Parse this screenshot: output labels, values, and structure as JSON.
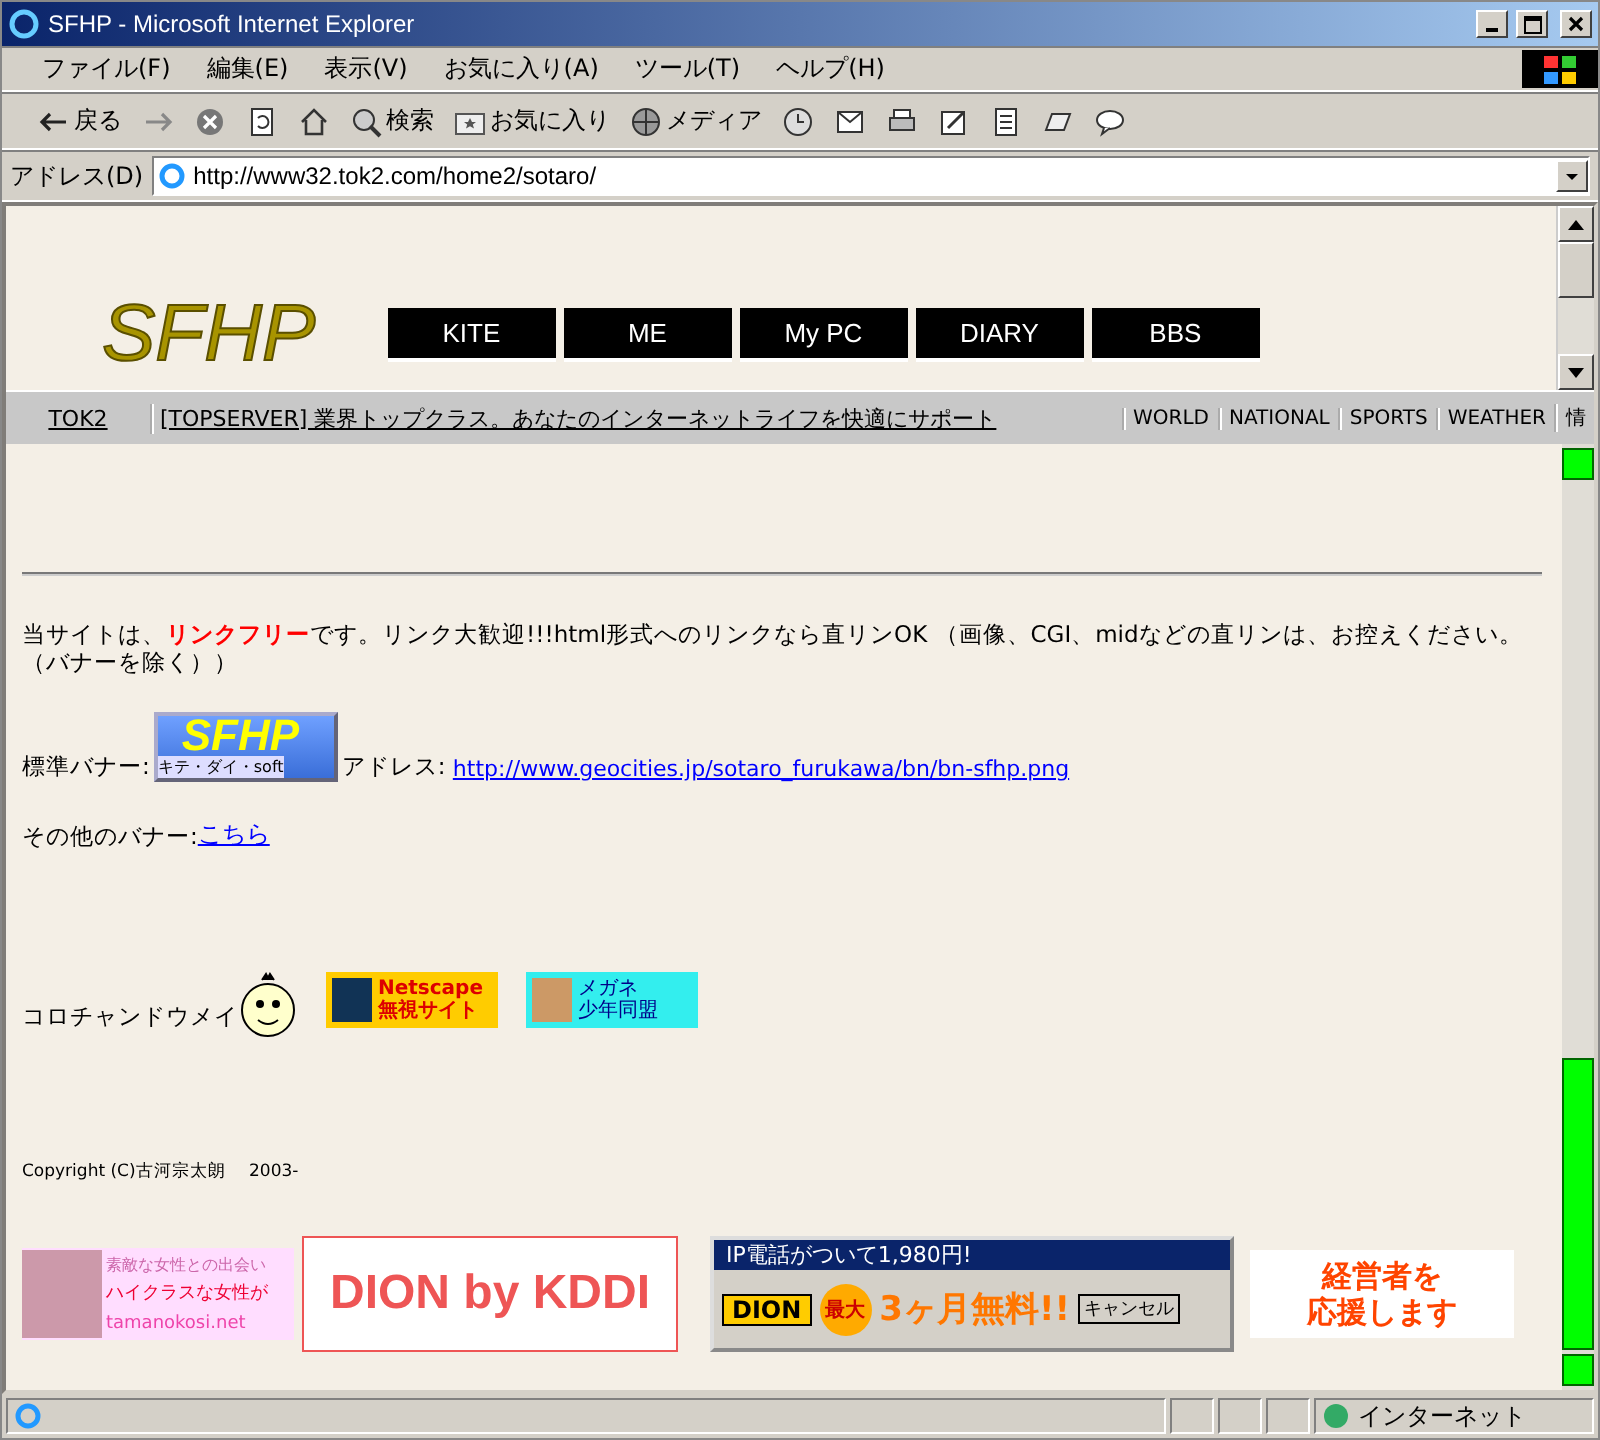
{
  "window": {
    "title": "SFHP - Microsoft Internet Explorer"
  },
  "menu": [
    "ファイル(F)",
    "編集(E)",
    "表示(V)",
    "お気に入り(A)",
    "ツール(T)",
    "ヘルプ(H)"
  ],
  "toolbar": [
    {
      "kind": "back",
      "label": "戻る"
    },
    {
      "kind": "forward"
    },
    {
      "kind": "stop"
    },
    {
      "kind": "refresh"
    },
    {
      "kind": "home"
    },
    {
      "kind": "search",
      "label": "検索"
    },
    {
      "kind": "favorites",
      "label": "お気に入り"
    },
    {
      "kind": "media",
      "label": "メディア"
    },
    {
      "kind": "history"
    },
    {
      "kind": "mail"
    },
    {
      "kind": "print"
    },
    {
      "kind": "edit"
    },
    {
      "kind": "discuss"
    },
    {
      "kind": "messenger"
    },
    {
      "kind": "chat"
    }
  ],
  "address": {
    "label": "アドレス(D)",
    "url": "http://www32.tok2.com/home2/sotaro/"
  },
  "header": {
    "logo": "SFHP",
    "nav": [
      "KITE",
      "ME",
      "My PC",
      "DIARY",
      "BBS"
    ]
  },
  "adbar": {
    "brand": "TOK2",
    "ad": "[TOPSERVER] 業界トップクラス。あなたのインターネットライフを快適にサポート",
    "links": [
      "WORLD",
      "NATIONAL",
      "SPORTS",
      "WEATHER",
      "情"
    ]
  },
  "content": {
    "link_policy": "当サイトは、**リンクフリー**です。リンク大歓迎!!!html形式へのリンクなら直リンOK （画像、CGI、midなどの直リンは、お控えください。（バナーを除く））",
    "banner_label": "標準バナー:",
    "banner_logo": "SFHP",
    "banner_caption": "キテ・ダイ・soft",
    "address_label": "アドレス:",
    "banner_url": "http://www.geocities.jp/sotaro_furukawa/bn/bn-sfhp.png",
    "other_label": "その他のバナー:",
    "other_link": "こちら",
    "mascot_label": "コロチャンドウメイ",
    "badges": [
      {
        "kind": "netscape",
        "line1": "Netscape",
        "line2": "無視サイト"
      },
      {
        "kind": "megane",
        "line1": "メガネ",
        "line2": "少年同盟"
      }
    ],
    "copyright": "Copyright (C)古河宗太朗　 2003-"
  },
  "ads": {
    "dating": [
      "素敵な女性との出会い",
      "ハイクラスな女性が",
      "tamanokosi.net"
    ],
    "dion": "DION by KDDI",
    "dialog": {
      "title": "IP電話がついて1,980円!",
      "brand": "DION",
      "tag": "最大",
      "offer": "3ヶ月無料!!",
      "cancel": "キャンセル"
    },
    "support": [
      "経営者を",
      "応援します"
    ]
  },
  "status_bar": {
    "zone": "インターネット"
  }
}
